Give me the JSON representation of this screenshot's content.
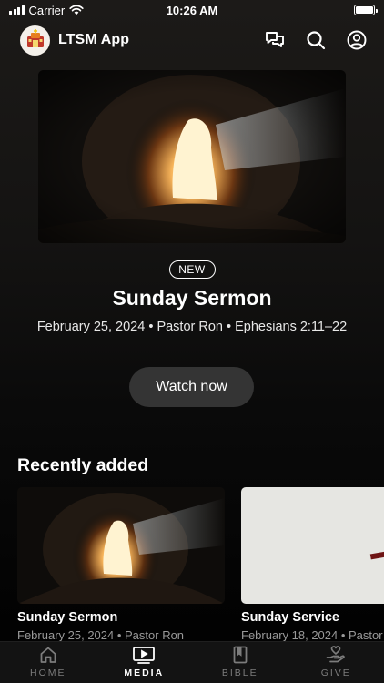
{
  "status_bar": {
    "carrier": "Carrier",
    "time": "10:26 AM"
  },
  "header": {
    "app_title": "LTSM App",
    "icons": [
      "chat-icon",
      "search-icon",
      "profile-icon"
    ]
  },
  "featured": {
    "badge": "NEW",
    "title": "Sunday Sermon",
    "meta": "February 25, 2024 • Pastor Ron • Ephesians 2:11–22",
    "button_label": "Watch now"
  },
  "recently_added": {
    "heading": "Recently added",
    "items": [
      {
        "title": "Sunday Sermon",
        "meta": "February 25, 2024 • Pastor Ron"
      },
      {
        "title": "Sunday Service",
        "meta": "February 18, 2024 • Pastor"
      }
    ]
  },
  "tabs": [
    {
      "label": "HOME",
      "icon": "home-icon",
      "active": false
    },
    {
      "label": "MEDIA",
      "icon": "media-icon",
      "active": true
    },
    {
      "label": "BIBLE",
      "icon": "bible-icon",
      "active": false
    },
    {
      "label": "GIVE",
      "icon": "give-icon",
      "active": false
    }
  ],
  "colors": {
    "button_bg": "#343434",
    "inactive_tab": "#7c7c7c",
    "active_tab": "#ffffff"
  }
}
